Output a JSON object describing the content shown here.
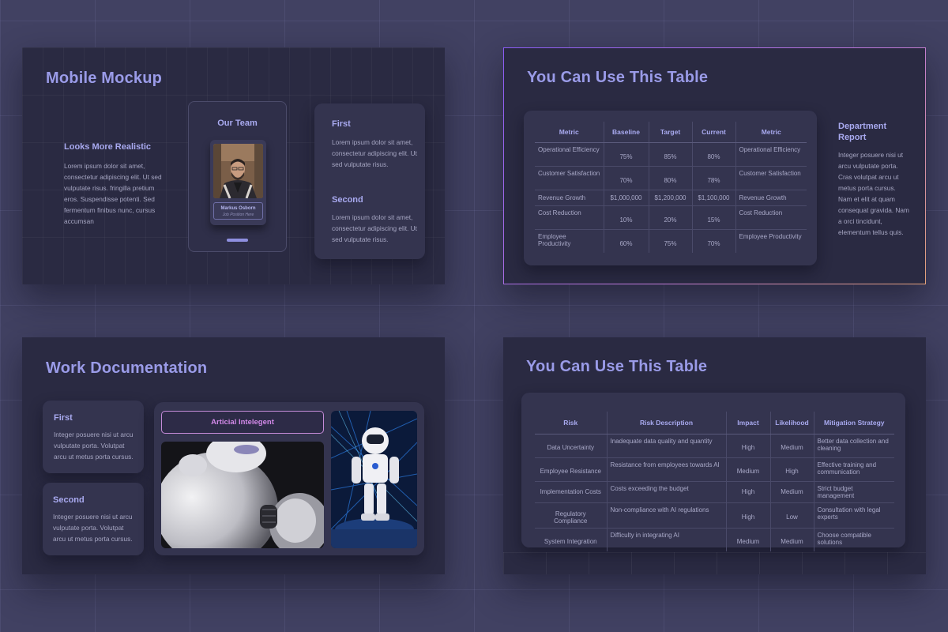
{
  "slide1": {
    "title": "Mobile Mockup",
    "left": {
      "heading": "Looks More Realistic",
      "text": "Lorem ipsum dolor sit amet, consectetur adipiscing elit. Ut sed vulputate risus. fringilla pretium eros. Suspendisse potenti. Sed fermentum finibus nunc, cursus accumsan"
    },
    "phone": {
      "heading": "Our Team",
      "name": "Markus Osborn",
      "position": "Job Position Here"
    },
    "right": {
      "first_heading": "First",
      "first_text": "Lorem ipsum dolor sit amet, consectetur adipiscing elit. Ut sed vulputate risus.",
      "second_heading": "Second",
      "second_text": "Lorem ipsum dolor sit amet, consectetur adipiscing elit. Ut sed vulputate risus."
    }
  },
  "slide2": {
    "title": "You Can Use This Table",
    "table": {
      "headers": [
        "Metric",
        "Baseline",
        "Target",
        "Current",
        "Metric"
      ],
      "rows": [
        [
          "Operational Efficiency",
          "75%",
          "85%",
          "80%",
          "Operational Efficiency"
        ],
        [
          "Customer Satisfaction",
          "70%",
          "80%",
          "78%",
          "Customer Satisfaction"
        ],
        [
          "Revenue Growth",
          "$1,000,000",
          "$1,200,000",
          "$1,100,000",
          "Revenue Growth"
        ],
        [
          "Cost Reduction",
          "10%",
          "20%",
          "15%",
          "Cost Reduction"
        ],
        [
          "Employee Productivity",
          "60%",
          "75%",
          "70%",
          "Employee Productivity"
        ]
      ]
    },
    "side": {
      "heading": "Department Report",
      "text": "Integer posuere nisi ut arcu vulputate porta. Cras volutpat arcu ut metus porta cursus. Nam et elit at quam consequat gravida. Nam a orci tincidunt, elementum tellus quis."
    }
  },
  "slide3": {
    "title": "Work Documentation",
    "card1": {
      "heading": "First",
      "text": "Integer posuere nisi ut arcu vulputate porta. Volutpat arcu ut metus porta cursus."
    },
    "card2": {
      "heading": "Second",
      "text": "Integer posuere nisi ut arcu vulputate porta. Volutpat arcu ut metus porta cursus."
    },
    "label": "Articial Intelegent"
  },
  "slide4": {
    "title": "You Can Use This Table",
    "table": {
      "headers": [
        "Risk",
        "Risk Description",
        "Impact",
        "Likelihood",
        "Mitigation Strategy"
      ],
      "rows": [
        [
          "Data Uncertainty",
          "Inadequate data quality and quantity",
          "High",
          "Medium",
          "Better data collection and cleaning"
        ],
        [
          "Employee Resistance",
          "Resistance from employees towards AI",
          "Medium",
          "High",
          "Effective training and communication"
        ],
        [
          "Implementation Costs",
          "Costs exceeding the budget",
          "High",
          "Medium",
          "Strict budget management"
        ],
        [
          "Regulatory Compliance",
          "Non-compliance with AI regulations",
          "High",
          "Low",
          "Consultation with legal experts"
        ],
        [
          "System Integration",
          "Difficulty in integrating AI",
          "Medium",
          "Medium",
          "Choose compatible solutions"
        ]
      ]
    }
  }
}
